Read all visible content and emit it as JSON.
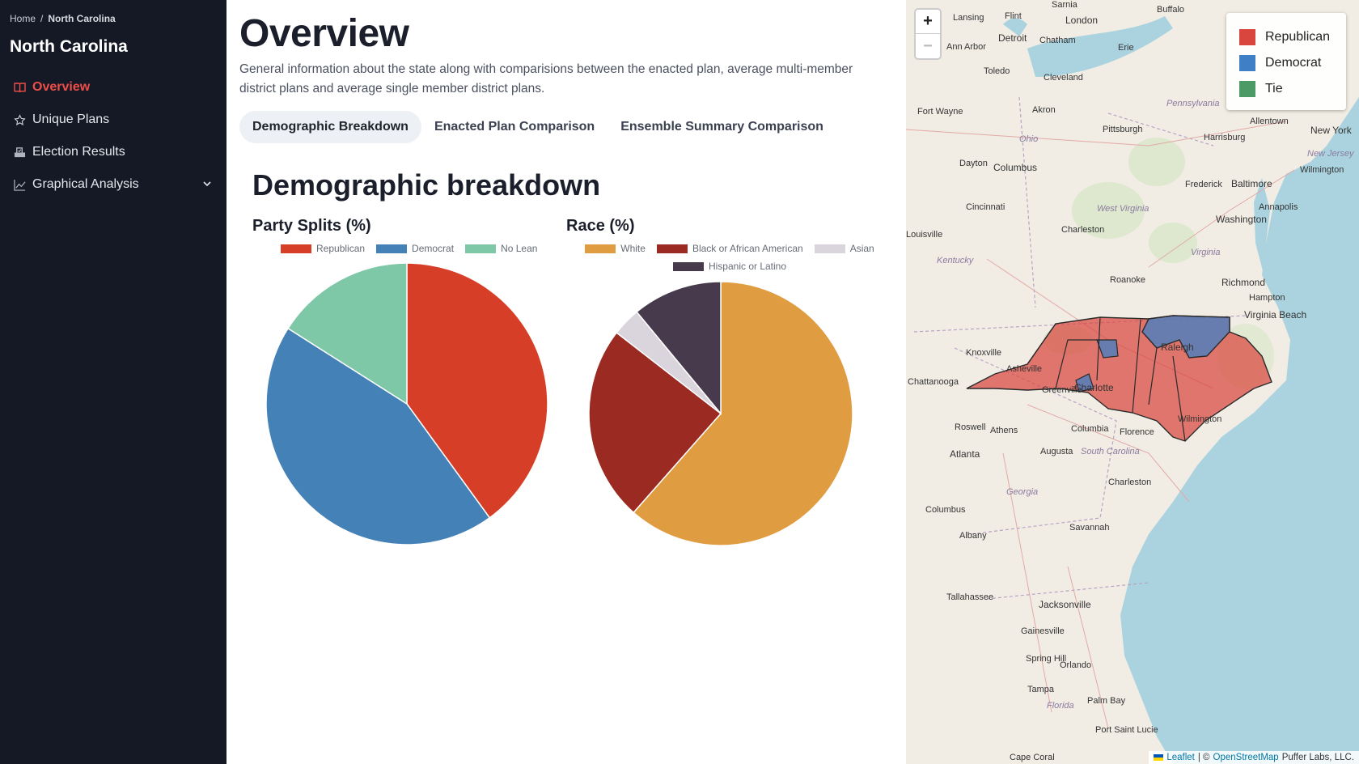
{
  "breadcrumb": {
    "home": "Home",
    "sep": "/",
    "current": "North Carolina"
  },
  "sidebar": {
    "title": "North Carolina",
    "items": [
      {
        "label": "Overview",
        "icon": "book-icon"
      },
      {
        "label": "Unique Plans",
        "icon": "star-icon"
      },
      {
        "label": "Election Results",
        "icon": "ballot-icon"
      },
      {
        "label": "Graphical Analysis",
        "icon": "line-chart-icon"
      }
    ]
  },
  "main": {
    "title": "Overview",
    "description": "General information about the state along with comparisions between the enacted plan, average multi-member district plans and average single member district plans.",
    "tabs": [
      {
        "label": "Demographic Breakdown"
      },
      {
        "label": "Enacted Plan Comparison"
      },
      {
        "label": "Ensemble Summary Comparison"
      }
    ],
    "section_title": "Demographic breakdown"
  },
  "colors": {
    "republican": "#d63e28",
    "democrat": "#4481b6",
    "no_lean": "#7ec8a8",
    "white": "#e09c41",
    "black": "#9a2a22",
    "asian": "#dad5dc",
    "hispanic": "#473a4c",
    "accent": "#ef4d48"
  },
  "chart_data": [
    {
      "type": "pie",
      "title": "Party Splits (%)",
      "categories": [
        "Republican",
        "Democrat",
        "No Lean"
      ],
      "values": [
        40,
        44,
        16
      ],
      "legend_position": "top"
    },
    {
      "type": "pie",
      "title": "Race (%)",
      "categories": [
        "White",
        "Black or African American",
        "Asian",
        "Hispanic or Latino"
      ],
      "values": [
        61.5,
        24,
        3.5,
        11
      ],
      "legend_position": "top"
    }
  ],
  "map": {
    "zoom_in": "+",
    "zoom_out": "−",
    "legend": [
      {
        "label": "Republican",
        "color": "#d9463e"
      },
      {
        "label": "Democrat",
        "color": "#3f7fc6"
      },
      {
        "label": "Tie",
        "color": "#4c9a66"
      }
    ],
    "attribution": {
      "leaflet": "Leaflet",
      "sep": "| ©",
      "osm": "OpenStreetMap",
      "owner": "Puffer Labs, LLC."
    },
    "labels": [
      "Lansing",
      "Flint",
      "Detroit",
      "London",
      "Sarnia",
      "Buffalo",
      "Ann Arbor",
      "Chatham",
      "Erie",
      "Toledo",
      "Cleveland",
      "Fort Wayne",
      "Akron",
      "Pittsburgh",
      "Harrisburg",
      "Allentown",
      "New York",
      "Dayton",
      "Columbus",
      "Ohio",
      "Pennsylvania",
      "New Jersey",
      "Wilmington",
      "Frederick",
      "Baltimore",
      "Annapolis",
      "Cincinnati",
      "Washington",
      "West Virginia",
      "Charleston",
      "Kentucky",
      "Virginia",
      "Roanoke",
      "Richmond",
      "Hampton",
      "Virginia Beach",
      "Knoxville",
      "Asheville",
      "Greenville",
      "Raleigh",
      "Charlotte",
      "Chattanooga",
      "Wilmington",
      "Roswell",
      "Athens",
      "Atlanta",
      "Columbia",
      "Florence",
      "Augusta",
      "South Carolina",
      "Charleston",
      "Georgia",
      "Columbus",
      "Savannah",
      "Albany",
      "Tallahassee",
      "Jacksonville",
      "Gainesville",
      "Orlando",
      "Spring Hill",
      "Tampa",
      "Florida",
      "Palm Bay",
      "Port Saint Lucie",
      "Cape Coral",
      "Louisville"
    ]
  }
}
